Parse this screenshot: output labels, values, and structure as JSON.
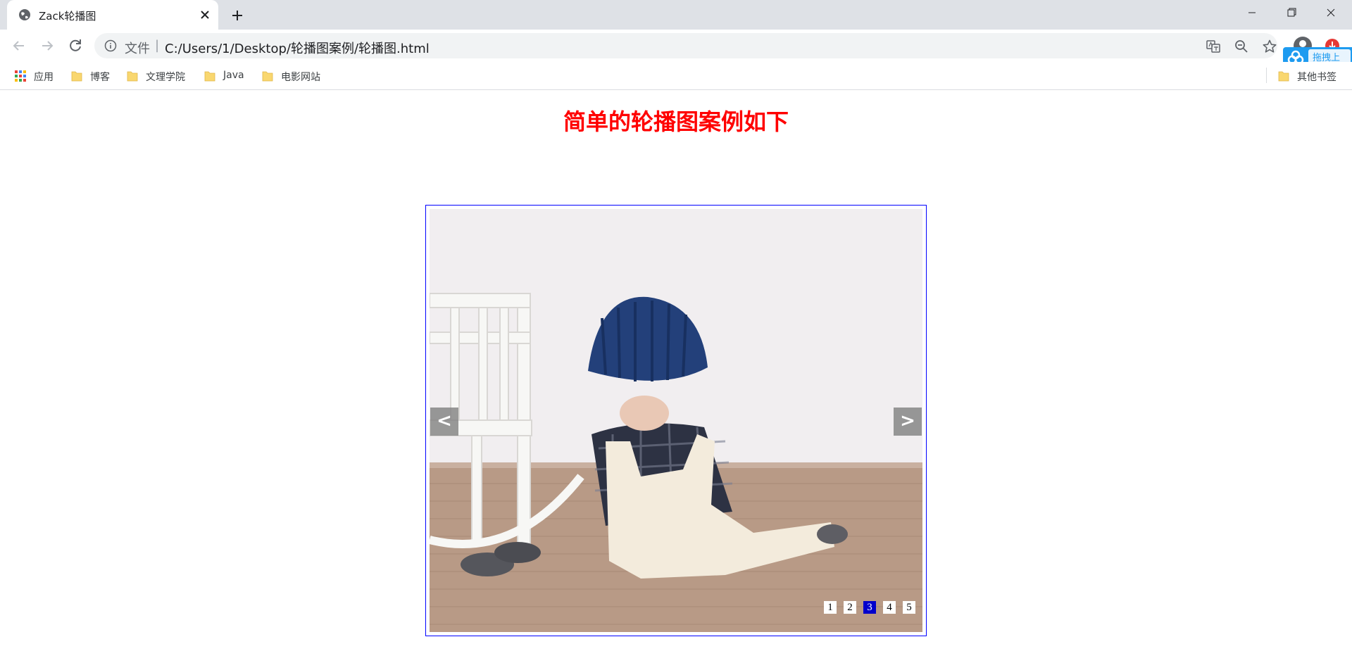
{
  "browser": {
    "tab_title": "Zack轮播图",
    "address_scheme": "文件",
    "address_separator": "|",
    "url": "C:/Users/1/Desktop/轮播图案例/轮播图.html",
    "baidu_float_label": "拖拽上"
  },
  "bookmarks": [
    {
      "label": "应用",
      "icon": "apps-grid-icon"
    },
    {
      "label": "博客",
      "icon": "folder-icon"
    },
    {
      "label": "文理学院",
      "icon": "folder-icon"
    },
    {
      "label": "Java",
      "icon": "folder-icon"
    },
    {
      "label": "电影网站",
      "icon": "folder-icon"
    }
  ],
  "other_bookmarks": "其他书签",
  "page": {
    "heading": "简单的轮播图案例如下",
    "prev_label": "<",
    "next_label": ">",
    "indicators": [
      "1",
      "2",
      "3",
      "4",
      "5"
    ],
    "active_indicator": 3
  },
  "colors": {
    "heading": "#ff0000",
    "carousel_border": "#0000ff",
    "active_indicator": "#0000cc"
  }
}
